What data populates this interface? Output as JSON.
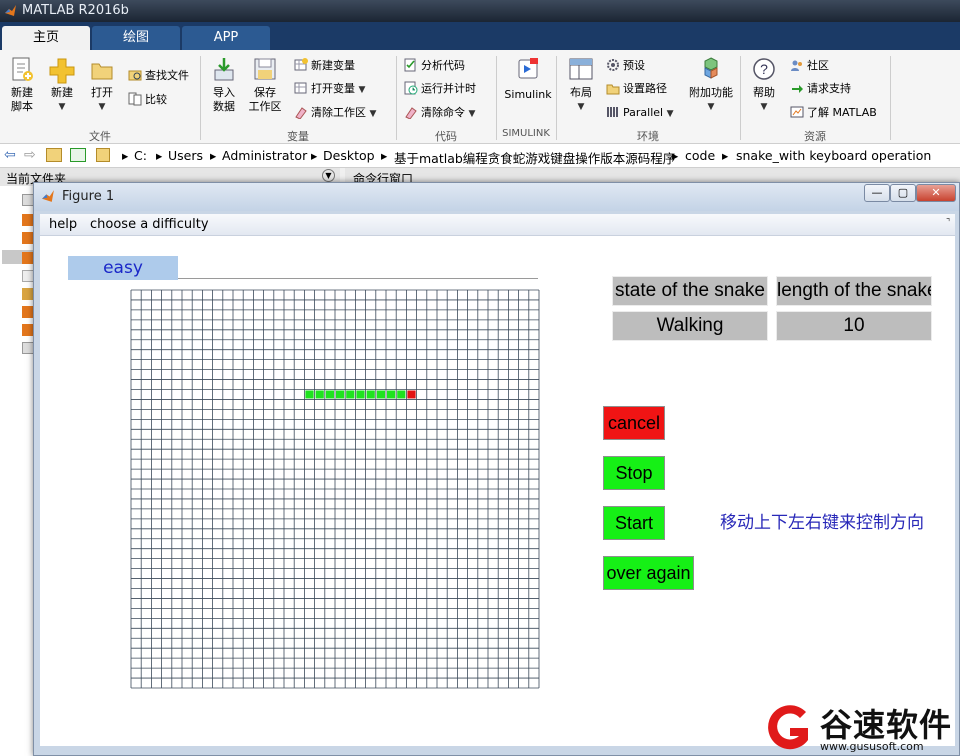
{
  "app": {
    "title": "MATLAB R2016b"
  },
  "tabs": [
    {
      "label": "主页",
      "active": true
    },
    {
      "label": "绘图",
      "active": false
    },
    {
      "label": "APP",
      "active": false
    }
  ],
  "ribbon": {
    "file": {
      "new_script": [
        "新建",
        "脚本"
      ],
      "new": "新建",
      "open": "打开",
      "find_files": "查找文件",
      "compare": "比较",
      "group_label": "文件"
    },
    "variable": {
      "import": [
        "导入",
        "数据"
      ],
      "save": [
        "保存",
        "工作区"
      ],
      "new_var": "新建变量",
      "open_var": "打开变量",
      "clear_ws": "清除工作区",
      "group_label": "变量"
    },
    "code": {
      "analyze": "分析代码",
      "run_time": "运行并计时",
      "clear_cmd": "清除命令",
      "group_label": "代码"
    },
    "simulink": {
      "label": "Simulink",
      "group_label": "SIMULINK"
    },
    "env": {
      "layout": "布局",
      "prefs": "预设",
      "set_path": "设置路径",
      "parallel": "Parallel",
      "addons": "附加功能",
      "group_label": "环境"
    },
    "resources": {
      "help": "帮助",
      "community": "社区",
      "support": "请求支持",
      "learn": "了解 MATLAB",
      "group_label": "资源"
    }
  },
  "address": [
    "C:",
    "Users",
    "Administrator",
    "Desktop",
    "基于matlab编程贪食蛇游戏键盘操作版本源码程序",
    "code",
    "snake_with keyboard operation"
  ],
  "panes": {
    "current_folder": "当前文件夹",
    "command_window": "命令行窗口"
  },
  "figure": {
    "title": "Figure 1",
    "menu": [
      "help",
      "choose a difficulty"
    ],
    "difficulty": "easy",
    "state_header": "state of the snake",
    "length_header": "length of the snake",
    "state_value": "Walking",
    "length_value": "10",
    "buttons": {
      "cancel": "cancel",
      "stop": "Stop",
      "start": "Start",
      "over_again": "over again"
    },
    "hint": "移动上下左右键来控制方向",
    "grid": {
      "cols": 40,
      "rows": 40
    },
    "snake": {
      "row": 10,
      "body_cols": [
        17,
        18,
        19,
        20,
        21,
        22,
        23,
        24,
        25,
        26
      ],
      "head_col": 27
    }
  },
  "colors": {
    "snake_body": "#1ee31e",
    "snake_head": "#e31212",
    "cancel_bg": "#f01414",
    "button_green": "#16f016",
    "grid_line": "#3b4a5a"
  },
  "watermark": {
    "text": "谷速软件",
    "url": "www.gususoft.com"
  }
}
